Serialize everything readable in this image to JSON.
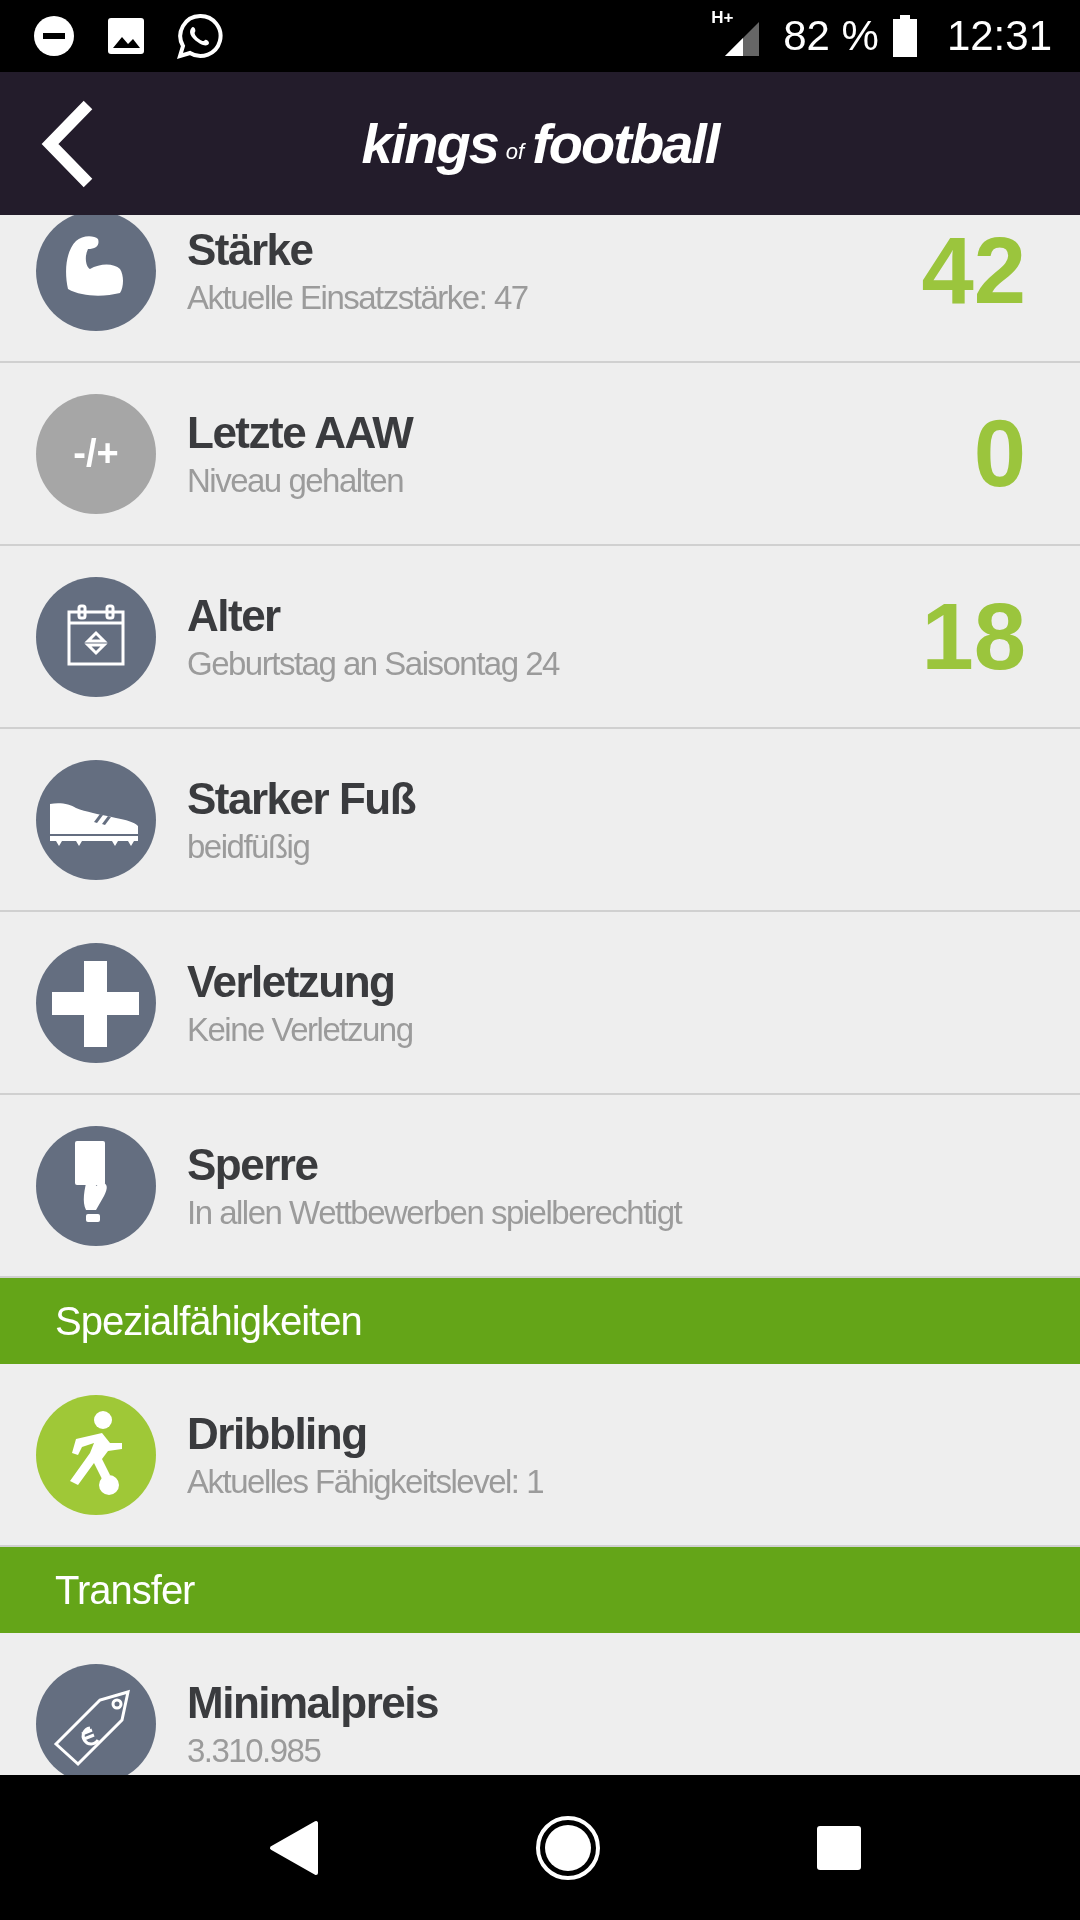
{
  "status_bar": {
    "network": "H+",
    "battery": "82 %",
    "time": "12:31"
  },
  "header": {
    "logo": [
      "kings",
      "of",
      "football"
    ]
  },
  "sections": [
    {
      "items": [
        {
          "kind": "muscle",
          "color": "#646e80",
          "title": "Stärke",
          "subtitle": "Aktuelle Einsatzstärke: 47",
          "value": "42"
        },
        {
          "kind": "text",
          "icon_text": "-/+",
          "color": "#a6a6a6",
          "title": "Letzte AAW",
          "subtitle": "Niveau gehalten",
          "value": "0"
        },
        {
          "kind": "calendar",
          "color": "#646e80",
          "title": "Alter",
          "subtitle": "Geburtstag an Saisontag 24",
          "value": "18"
        },
        {
          "kind": "boot",
          "color": "#646e80",
          "title": "Starker Fuß",
          "subtitle": "beidfüßig"
        },
        {
          "kind": "cross",
          "color": "#646e80",
          "title": "Verletzung",
          "subtitle": "Keine Verletzung"
        },
        {
          "kind": "card",
          "color": "#646e80",
          "title": "Sperre",
          "subtitle": "In allen Wettbewerben spielberechtigt"
        }
      ]
    },
    {
      "title": "Spezialfähigkeiten",
      "items": [
        {
          "kind": "player",
          "color": "#9fc837",
          "title": "Dribbling",
          "subtitle": "Aktuelles Fähigkeitslevel: 1"
        }
      ]
    },
    {
      "title": "Transfer",
      "items": [
        {
          "kind": "tag",
          "color": "#646e80",
          "title": "Minimalpreis",
          "subtitle": "3.310.985"
        }
      ]
    }
  ]
}
